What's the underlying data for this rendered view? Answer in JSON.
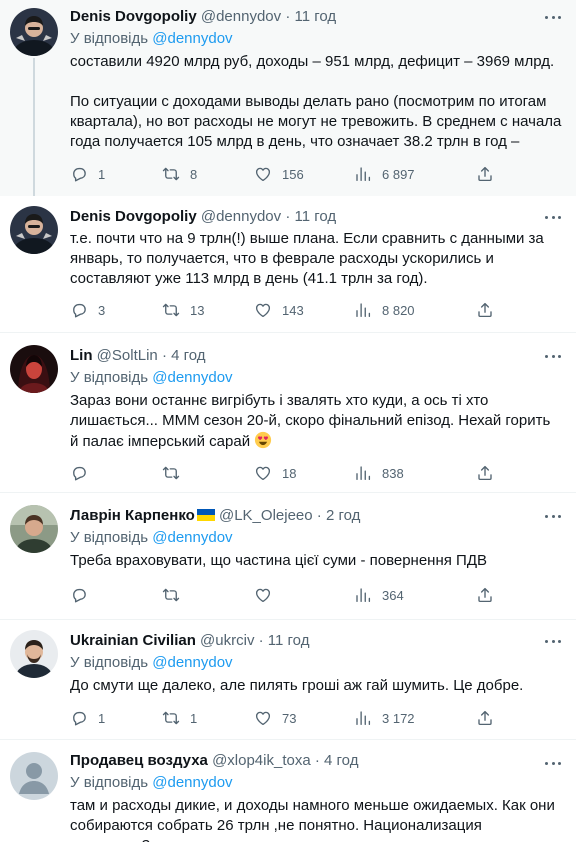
{
  "reply_prefix": "У відповідь",
  "tweets": [
    {
      "name": "Denis Dovgopoliy",
      "handle": "@dennydov",
      "time": "11 год",
      "reply_to": "@dennydov",
      "text": [
        "составили 4920 млрд руб, доходы – 951 млрд, дефицит – 3969 млрд.",
        "По ситуации с доходами выводы делать рано (посмотрим по итогам квартала), но вот расходы не могут не тревожить. В среднем с начала года получается 105 млрд в день, что означает 38.2 трлн в год –"
      ],
      "replies": "1",
      "retweets": "8",
      "likes": "156",
      "views": "6 897"
    },
    {
      "name": "Denis Dovgopoliy",
      "handle": "@dennydov",
      "time": "11 год",
      "text": "т.е. почти что на 9 трлн(!) выше плана. Если сравнить с данными за январь, то получается, что в феврале расходы ускорились и составляют уже 113 млрд в день (41.1 трлн за год).",
      "replies": "3",
      "retweets": "13",
      "likes": "143",
      "views": "8 820"
    },
    {
      "name": "Lin",
      "handle": "@SoltLin",
      "time": "4 год",
      "reply_to": "@dennydov",
      "text": "Зараз вони останнє вигрібуть і звалять хто куди, а ось ті хто лишається... МММ сезон 20-й, скоро фінальний епізод. Нехай горить й палає імперський сарай",
      "replies": "",
      "retweets": "",
      "likes": "18",
      "views": "838"
    },
    {
      "name": "Лаврін Карпенко",
      "handle": "@LK_Olejeeo",
      "time": "2 год",
      "reply_to": "@dennydov",
      "text": "Треба враховувати, що частина цієї суми - повернення ПДВ",
      "replies": "",
      "retweets": "",
      "likes": "",
      "views": "364"
    },
    {
      "name": "Ukrainian Civilian",
      "handle": "@ukrciv",
      "time": "11 год",
      "reply_to": "@dennydov",
      "text": "До смути ще далеко, але пилять гроші аж гай шумить. Це добре.",
      "replies": "1",
      "retweets": "1",
      "likes": "73",
      "views": "3 172"
    },
    {
      "name": "Продавец воздуха",
      "handle": "@xlop4ik_toxa",
      "time": "4 год",
      "reply_to": "@dennydov",
      "text": "там и расходы дикие, и доходы намного меньше ожидаемых. Как они собираются собрать 26 трлн ,не понятно. Национализация депозитов?"
    }
  ],
  "colors": {
    "accent": "#1d9bf0",
    "secondary_text": "#536471",
    "thread_line": "#cfd9de"
  },
  "icons": {
    "reply": "reply-icon",
    "retweet": "retweet-icon",
    "like": "heart-icon",
    "views": "views-icon",
    "share": "share-icon",
    "more": "more-icon"
  }
}
